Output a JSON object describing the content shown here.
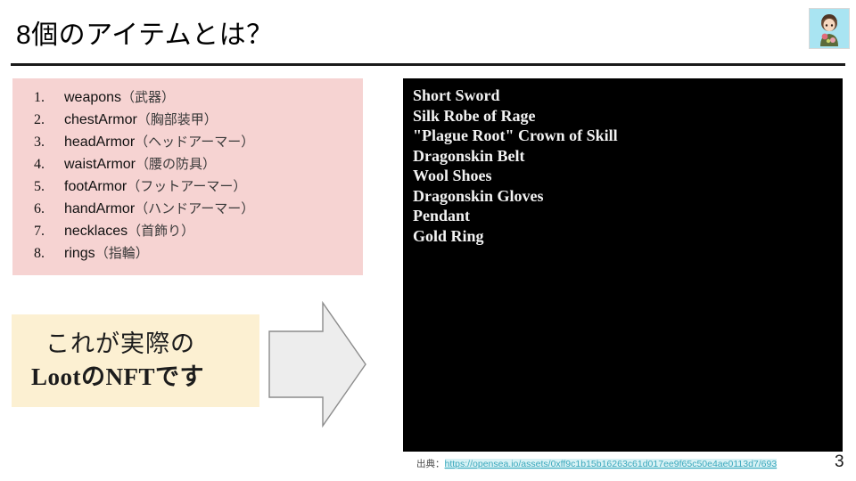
{
  "slide": {
    "title": "8個のアイテムとは？",
    "page_number": "3"
  },
  "avatar": {
    "name": "presenter-avatar",
    "background_color": "#a9e4f2"
  },
  "item_list": {
    "background_color": "#f6d3d2",
    "items": [
      {
        "num": "1.",
        "name": "weapons",
        "jp": "（武器）"
      },
      {
        "num": "2.",
        "name": "chestArmor",
        "jp": "（胸部装甲）"
      },
      {
        "num": "3.",
        "name": "headArmor",
        "jp": "（ヘッドアーマー）"
      },
      {
        "num": "4.",
        "name": "waistArmor",
        "jp": "（腰の防具）"
      },
      {
        "num": "5.",
        "name": "footArmor",
        "jp": "（フットアーマー）"
      },
      {
        "num": "6.",
        "name": "handArmor",
        "jp": "（ハンドアーマー）"
      },
      {
        "num": "7.",
        "name": "necklaces",
        "jp": "（首飾り）"
      },
      {
        "num": "8.",
        "name": "rings",
        "jp": "（指輪）"
      }
    ]
  },
  "callout": {
    "background_color": "#fcf0d2",
    "line1": "これが実際の",
    "line2": "LootのNFTです"
  },
  "arrow": {
    "name": "right-arrow",
    "fill_color": "#ededed",
    "stroke_color": "#8c8c8c"
  },
  "nft_panel": {
    "background_color": "#000000",
    "text_color": "#f2f2f2",
    "lines": [
      "Short Sword",
      "Silk Robe of Rage",
      "\"Plague Root\" Crown of Skill",
      "Dragonskin Belt",
      "Wool Shoes",
      "Dragonskin Gloves",
      "Pendant",
      "Gold Ring"
    ]
  },
  "source": {
    "label": "出典：",
    "url": "https://opensea.io/assets/0xff9c1b15b16263c61d017ee9f65c50e4ae0113d7/693",
    "link_color": "#3ba8bd"
  }
}
